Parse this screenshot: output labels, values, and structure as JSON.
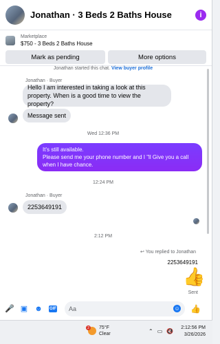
{
  "header": {
    "title": "Jonathan · 3 Beds 2 Baths House",
    "info_icon": "info-icon",
    "info_glyph": "i"
  },
  "listing": {
    "kind": "Marketplace",
    "summary": "$750 - 3 Beds 2 Baths House",
    "mark_pending_label": "Mark as pending",
    "more_options_label": "More options"
  },
  "messages": {
    "started_text": "Jonathan started this chat.",
    "view_profile_link": "View buyer profile",
    "sender_1": "Jonathan · Buyer",
    "msg_1": "Hello I am interested in taking a look at this property. When is a good time to view the property?",
    "msg_2": "Message sent",
    "time_1": "Wed 12:36 PM",
    "reply_1": "It's still available.\nPlease send me your phone number and I \"ll Give you a call when I have chance.",
    "time_2": "12:24 PM",
    "sender_2": "Jonathan · Buyer",
    "msg_3": "2253649191",
    "time_3": "2:12 PM",
    "reply_note": "You replied to Jonathan",
    "reply_quote": "2253649191",
    "status": "Sent"
  },
  "composer": {
    "placeholder": "Aa"
  },
  "taskbar": {
    "temperature": "75°F",
    "condition": "Clear",
    "weather_badge": "2",
    "time": "2:12:56 PM",
    "date": "3/26/2026"
  },
  "colors": {
    "accent": "#1877f2",
    "outgoing_bubble": "#8b2cf5",
    "info_button": "#9b2bf0"
  }
}
